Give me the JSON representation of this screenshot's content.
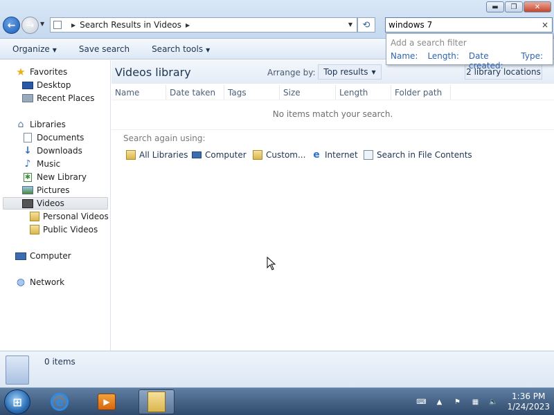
{
  "window": {
    "controls": {
      "minimize": "▬",
      "maximize": "❐",
      "close": "✕"
    }
  },
  "address": {
    "path": "Search Results in Videos"
  },
  "search": {
    "value": "windows 7",
    "clear": "×",
    "filter_title": "Add a search filter",
    "filters": [
      "Name:",
      "Length:",
      "Date created:",
      "Type:"
    ]
  },
  "command_bar": {
    "organize": "Organize",
    "save_search": "Save search",
    "search_tools": "Search tools"
  },
  "sidebar": {
    "favorites": "Favorites",
    "desktop": "Desktop",
    "recent_places": "Recent Places",
    "libraries": "Libraries",
    "documents": "Documents",
    "downloads": "Downloads",
    "music": "Music",
    "new_library": "New Library",
    "pictures": "Pictures",
    "videos": "Videos",
    "personal_videos": "Personal Videos",
    "public_videos": "Public Videos",
    "computer": "Computer",
    "network": "Network"
  },
  "library": {
    "title": "Videos library",
    "arrange_label": "Arrange by:",
    "arrange_value": "Top results",
    "locations": "2 library locations"
  },
  "columns": [
    "Name",
    "Date taken",
    "Tags",
    "Size",
    "Length",
    "Folder path"
  ],
  "empty_message": "No items match your search.",
  "search_again": {
    "label": "Search again using:",
    "options": [
      "All Libraries",
      "Computer",
      "Custom...",
      "Internet",
      "Search in File Contents"
    ]
  },
  "details": {
    "count": "0 items"
  },
  "taskbar": {
    "time": "1:36 PM",
    "date": "1/24/2023"
  }
}
